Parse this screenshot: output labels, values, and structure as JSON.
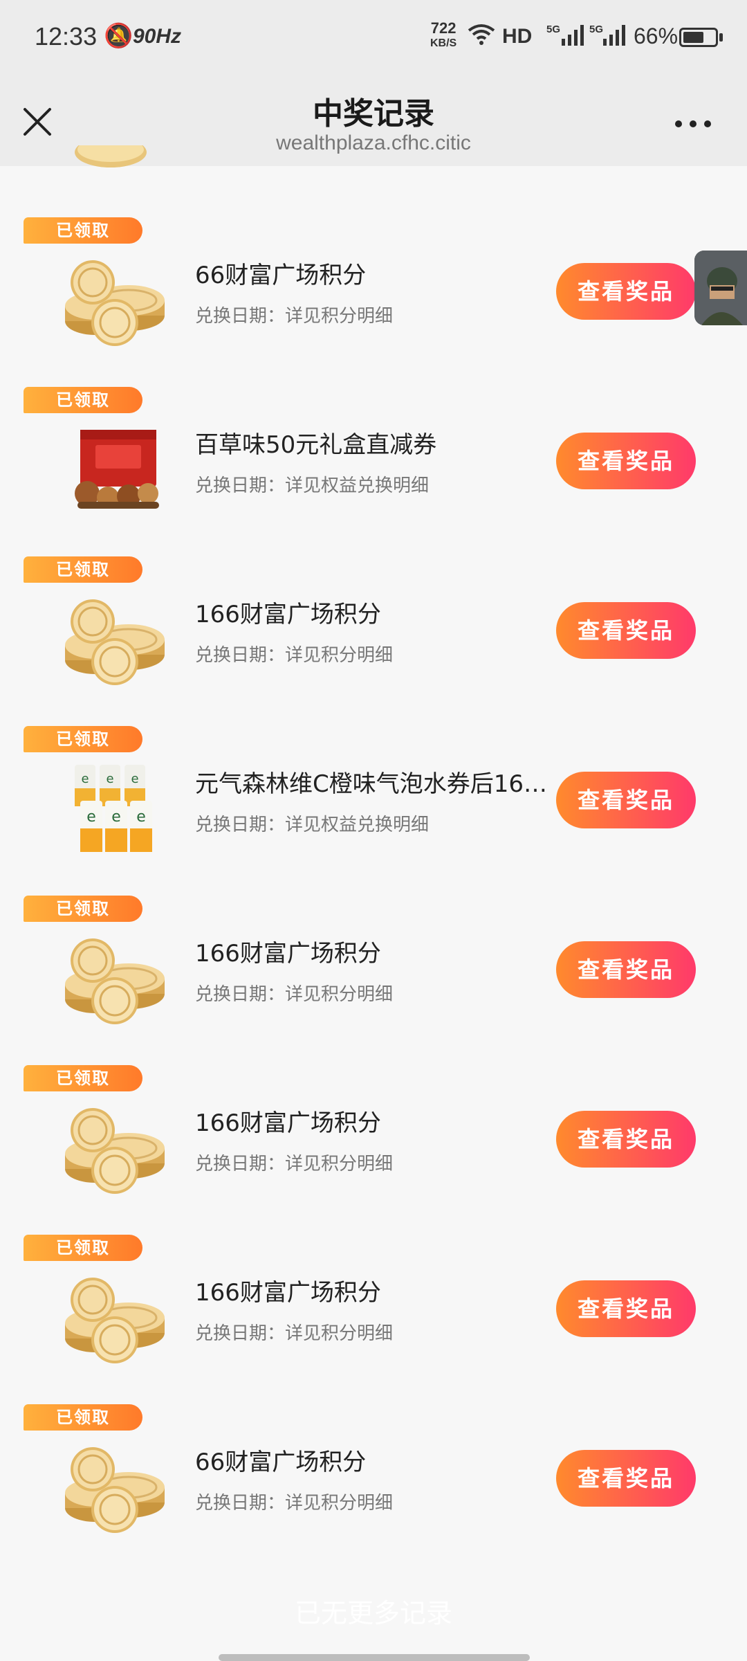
{
  "status_bar": {
    "time": "12:33",
    "refresh_rate": "90Hz",
    "net_speed_value": "722",
    "net_speed_unit": "KB/S",
    "hd_label": "HD",
    "sim1_label": "5G",
    "sim2_label": "5G",
    "battery_percent": "66%",
    "battery_level": 0.66
  },
  "navbar": {
    "title": "中奖记录",
    "url": "wealthplaza.cfhc.citic"
  },
  "colors": {
    "badge_start": "#ffb13d",
    "badge_end": "#ff7a2a",
    "button_start": "#ff8a2d",
    "button_end": "#ff3a6a",
    "page_bg": "#f7f7f7"
  },
  "records": [
    {
      "badge": "已领取",
      "thumb": "coin-stack",
      "title": "66财富广场积分",
      "subtitle": "兑换日期：详见积分明细",
      "button": "查看奖品"
    },
    {
      "badge": "已领取",
      "thumb": "gift-box",
      "title": "百草味50元礼盒直减券",
      "subtitle": "兑换日期：详见权益兑换明细",
      "button": "查看奖品"
    },
    {
      "badge": "已领取",
      "thumb": "coin-stack",
      "title": "166财富广场积分",
      "subtitle": "兑换日期：详见积分明细",
      "button": "查看奖品"
    },
    {
      "badge": "已领取",
      "thumb": "soda-cans",
      "title": "元气森林维C橙味气泡水券后16....",
      "subtitle": "兑换日期：详见权益兑换明细",
      "button": "查看奖品"
    },
    {
      "badge": "已领取",
      "thumb": "coin-stack",
      "title": "166财富广场积分",
      "subtitle": "兑换日期：详见积分明细",
      "button": "查看奖品"
    },
    {
      "badge": "已领取",
      "thumb": "coin-stack",
      "title": "166财富广场积分",
      "subtitle": "兑换日期：详见积分明细",
      "button": "查看奖品"
    },
    {
      "badge": "已领取",
      "thumb": "coin-stack",
      "title": "166财富广场积分",
      "subtitle": "兑换日期：详见积分明细",
      "button": "查看奖品"
    },
    {
      "badge": "已领取",
      "thumb": "coin-stack",
      "title": "66财富广场积分",
      "subtitle": "兑换日期：详见积分明细",
      "button": "查看奖品"
    }
  ],
  "footer": {
    "end_text": "已无更多记录"
  }
}
